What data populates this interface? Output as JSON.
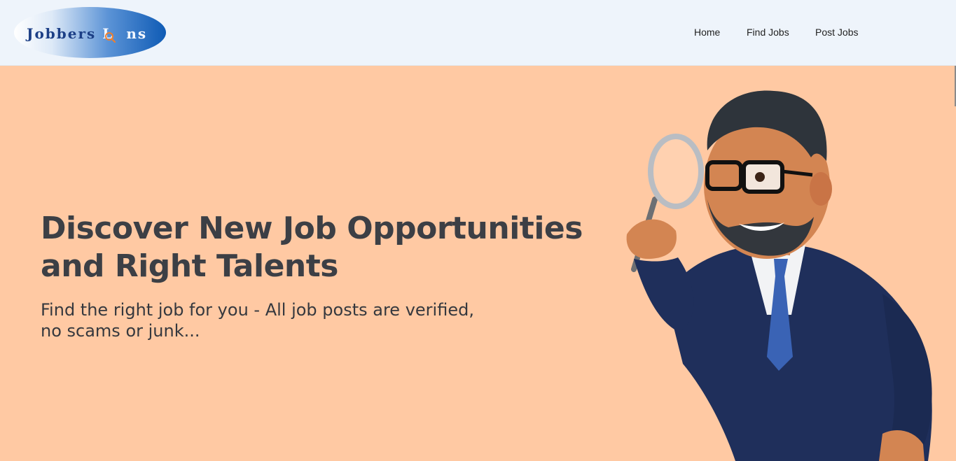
{
  "header": {
    "logo": {
      "word1": "Jobbers",
      "word2_part1": "L",
      "word2_part2": "ns",
      "icon": "magnifier-icon"
    },
    "nav": {
      "home": "Home",
      "find_jobs": "Find Jobs",
      "post_jobs": "Post Jobs"
    }
  },
  "hero": {
    "headline_line1": "Discover New Job Opportunities",
    "headline_line2": "and Right Talents",
    "subline_line1": "Find the right job for you - All job posts are verified,",
    "subline_line2": "no scams or junk...",
    "illustration": "businessman-with-magnifying-glass"
  },
  "colors": {
    "hero_bg": "#ffc9a3",
    "header_bg": "#eef4fb",
    "text_dark": "#3c3f45",
    "logo_blue": "#0f5bb5"
  }
}
